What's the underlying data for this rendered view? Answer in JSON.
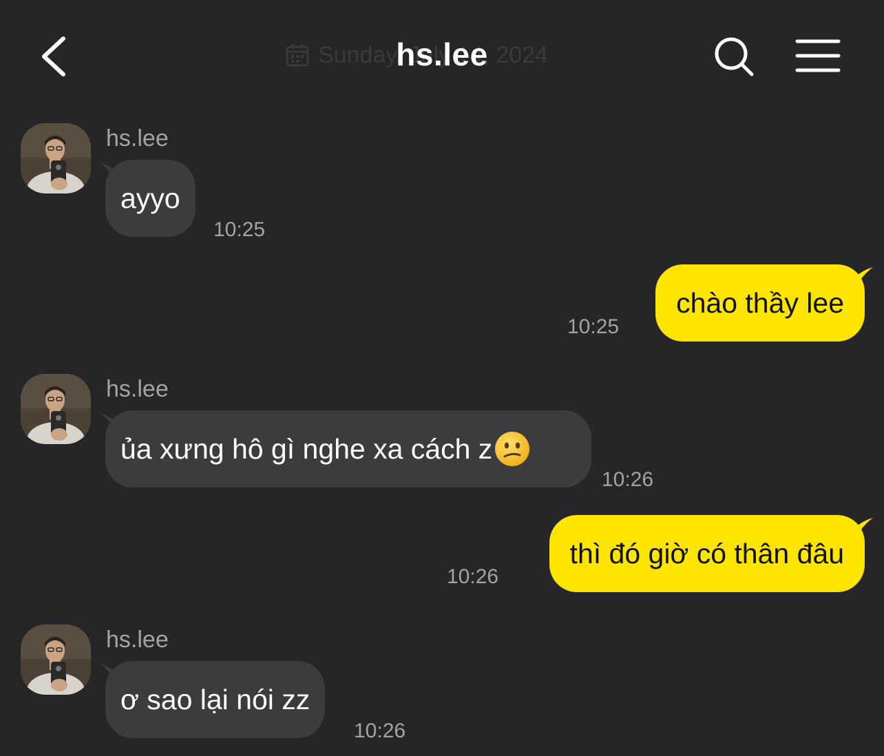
{
  "header": {
    "title": "hs.lee",
    "date_separator": "Sunday, July 14, 2024",
    "back_icon": "chevron-left-icon",
    "search_icon": "search-icon",
    "menu_icon": "hamburger-menu-icon"
  },
  "messages": [
    {
      "direction": "incoming",
      "sender": "hs.lee",
      "text": "ayyo",
      "time": "10:25"
    },
    {
      "direction": "outgoing",
      "text": "chào thầy lee",
      "time": "10:25"
    },
    {
      "direction": "incoming",
      "sender": "hs.lee",
      "text": "ủa xưng hô gì nghe xa cách z",
      "emoji": "confused-face",
      "time": "10:26"
    },
    {
      "direction": "outgoing",
      "text": "thì đó giờ có thân đâu",
      "time": "10:26"
    },
    {
      "direction": "incoming",
      "sender": "hs.lee",
      "text": "ơ sao lại nói zz",
      "time": "10:26"
    }
  ],
  "colors": {
    "background": "#262628",
    "incoming_bubble": "#3c3c3f",
    "outgoing_bubble": "#fee500",
    "muted_text": "#a4a4a8"
  }
}
